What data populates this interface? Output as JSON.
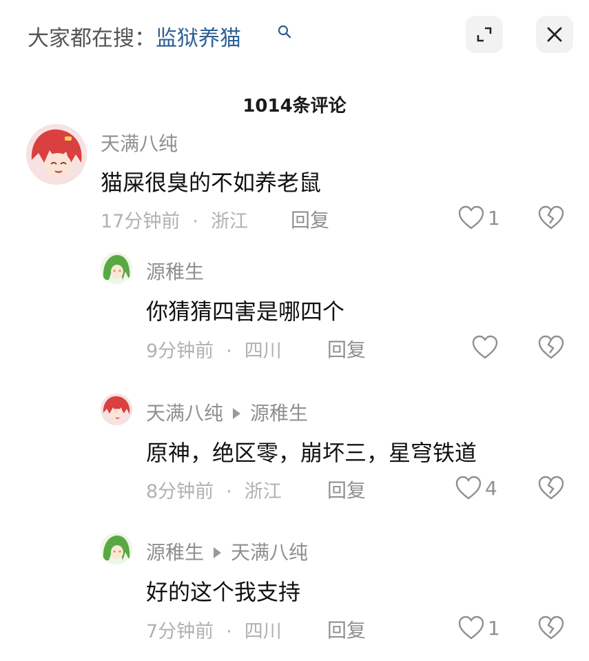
{
  "header": {
    "search_prefix": "大家都在搜：",
    "search_term": "监狱养猫"
  },
  "comment_count": "1014条评论",
  "comments": [
    {
      "user": "天满八纯",
      "text": "猫屎很臭的不如养老鼠",
      "time": "17分钟前",
      "location": "浙江",
      "reply_label": "回复",
      "likes": "1"
    },
    {
      "user": "源稚生",
      "text": "你猜猜四害是哪四个",
      "time": "9分钟前",
      "location": "四川",
      "reply_label": "回复",
      "likes": ""
    },
    {
      "user": "天满八纯",
      "reply_to": "源稚生",
      "text": "原神，绝区零，崩坏三，星穹铁道",
      "time": "8分钟前",
      "location": "浙江",
      "reply_label": "回复",
      "likes": "4"
    },
    {
      "user": "源稚生",
      "reply_to": "天满八纯",
      "text": "好的这个我支持",
      "time": "7分钟前",
      "location": "四川",
      "reply_label": "回复",
      "likes": "1"
    }
  ],
  "separator": "·",
  "icons": {
    "search": "search-icon",
    "expand": "expand-icon",
    "close": "close-icon",
    "like": "heart-icon",
    "dislike": "broken-heart-icon",
    "avatar_red": "red-hair-avatar",
    "avatar_green": "green-hair-avatar"
  },
  "colors": {
    "search_term": "#2f5f93",
    "meta": "#b1b1b1",
    "username": "#8f8f8f"
  }
}
